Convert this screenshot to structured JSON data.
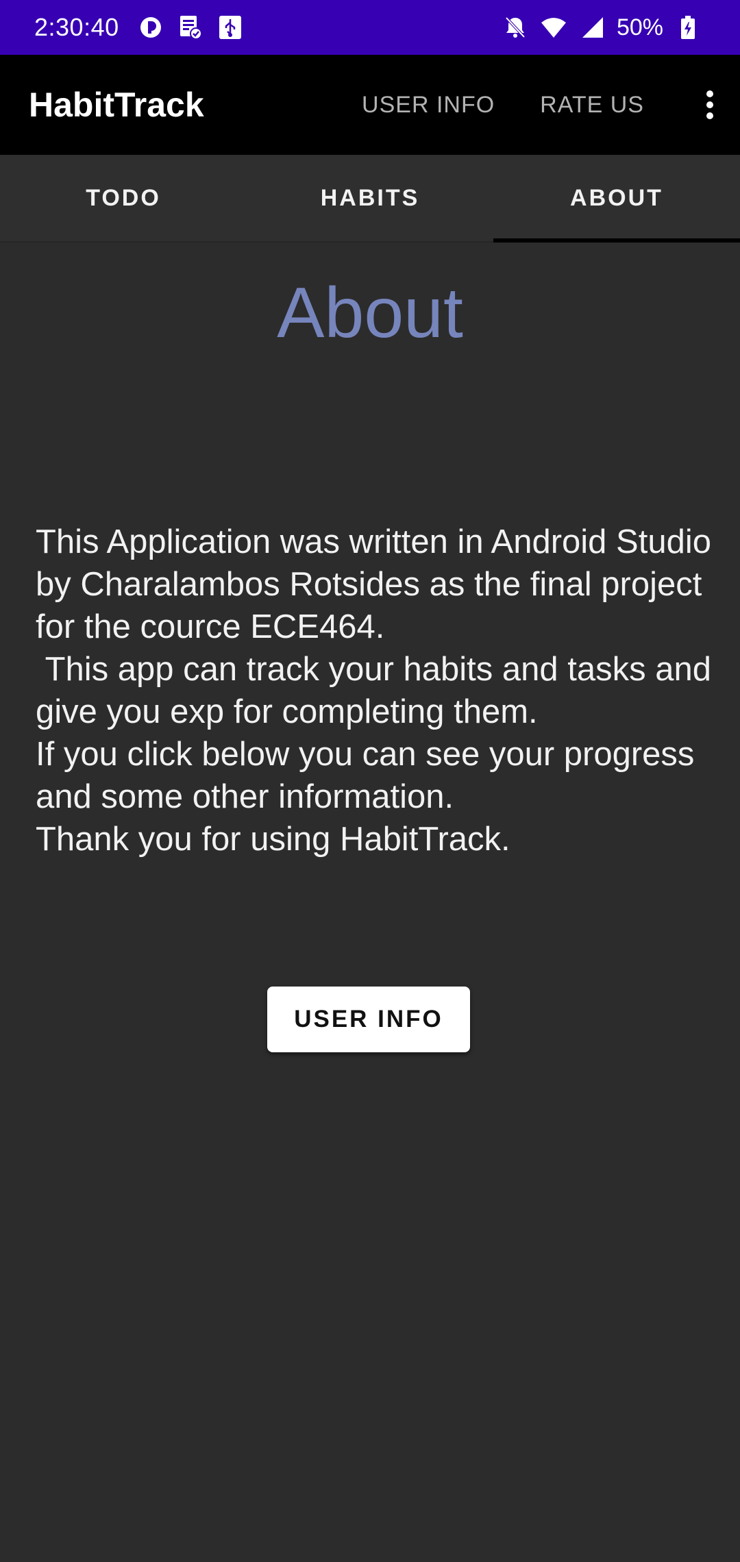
{
  "status_bar": {
    "time": "2:30:40",
    "battery": "50%",
    "left_icons": [
      "circle-app-icon",
      "task-check-icon",
      "usb-icon"
    ],
    "right_icons": [
      "bell-off-icon",
      "wifi-icon",
      "cell-signal-icon",
      "battery-charging-icon"
    ],
    "background": "#3700b3"
  },
  "app_bar": {
    "title": "HabitTrack",
    "actions": [
      "USER INFO",
      "RATE US"
    ],
    "overflow_icon": "more-vert-icon"
  },
  "tabs": [
    {
      "label": "TODO",
      "active": false
    },
    {
      "label": "HABITS",
      "active": false
    },
    {
      "label": "ABOUT",
      "active": true
    }
  ],
  "main": {
    "heading": "About",
    "body": "This Application was written in Android Studio by Charalambos Rotsides as the final project for the cource ECE464.\n This app can track your habits and tasks and give you exp for completing them.\nIf you click below you can see your progress and some other information.\nThank you for using HabitTrack.",
    "button_label": "USER INFO"
  },
  "colors": {
    "heading": "#7785bd",
    "background": "#2c2c2c",
    "app_bar": "#000000"
  }
}
